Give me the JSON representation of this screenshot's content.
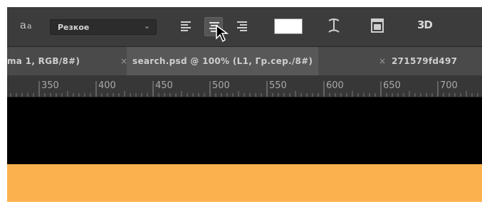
{
  "options_bar": {
    "antialias_icon": "aa-icon",
    "antialias_glyph_big": "a",
    "antialias_glyph_small": "a",
    "antialias_value": "Резкое",
    "antialias_chevron": "⌄",
    "align_left_icon": "align-left-icon",
    "align_center_icon": "align-center-icon",
    "align_right_icon": "align-right-icon",
    "text_color": "#ffffff",
    "warp_text_icon": "warp-text-icon",
    "panels_icon": "character-panels-icon",
    "three_d_label": "3D"
  },
  "tabs": [
    {
      "label": "ma 1, RGB/8#)",
      "active": false
    },
    {
      "label": "search.psd @ 100% (L1, Гр.сер./8#)",
      "active": true
    },
    {
      "label": "271579fd497",
      "active": false
    }
  ],
  "tab_close_glyph": "×",
  "ruler": {
    "labels": [
      "350",
      "400",
      "450",
      "500",
      "550",
      "600",
      "650",
      "700"
    ]
  },
  "canvas": {
    "top_color": "#000000",
    "bottom_color": "#fbb14e"
  }
}
